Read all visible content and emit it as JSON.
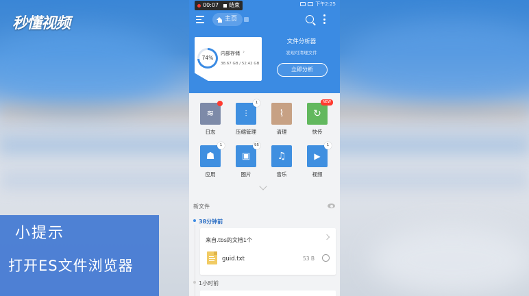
{
  "overlay": {
    "logo_text": "秒懂视频",
    "tip_title": "小提示",
    "tip_text": "打开ES文件浏览器"
  },
  "status_bar": {
    "recording_time": "00:07",
    "stop_label": "结束",
    "right_text": "下午2:25"
  },
  "app_bar": {
    "menu_icon": "menu-icon",
    "home_tab_label": "主页",
    "search_icon": "search-icon",
    "more_icon": "more-vert-icon"
  },
  "storage": {
    "percent_label": "74%",
    "percent_value": 74,
    "label": "内部存储",
    "size_text": "38.67 GB / 52.42 GB"
  },
  "analyzer": {
    "title": "文件分析器",
    "subtitle": "发现可清理文件",
    "button_label": "立即分析"
  },
  "tools": [
    {
      "label": "日志",
      "icon": "log-icon",
      "color": "#7d8aa8",
      "badge": "dot"
    },
    {
      "label": "压缩管理",
      "icon": "zip-icon",
      "color": "#3f8fe0",
      "badge": "1"
    },
    {
      "label": "清理",
      "icon": "broom-icon",
      "color": "#c7a184",
      "badge": ""
    },
    {
      "label": "快传",
      "icon": "quick-transfer-icon",
      "color": "#62b85e",
      "badge": "NEW"
    },
    {
      "label": "应用",
      "icon": "android-icon",
      "color": "#3f8fe0",
      "badge": "1"
    },
    {
      "label": "图片",
      "icon": "image-icon",
      "color": "#3f8fe0",
      "badge": "95"
    },
    {
      "label": "音乐",
      "icon": "music-icon",
      "color": "#3f8fe0",
      "badge": ""
    },
    {
      "label": "视频",
      "icon": "video-icon",
      "color": "#3f8fe0",
      "badge": "1"
    }
  ],
  "recent": {
    "heading": "新文件",
    "groups": [
      {
        "time": "38分钟前",
        "card_title": "来自.tbs的文档1个",
        "file_name": "guid.txt",
        "file_size": "53 B"
      },
      {
        "time": "1小时前"
      }
    ]
  }
}
